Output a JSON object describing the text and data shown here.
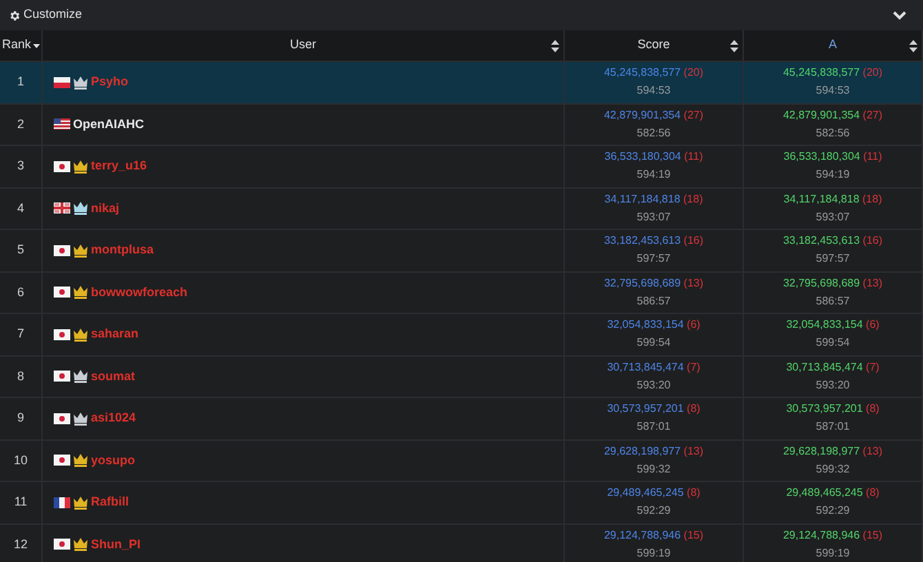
{
  "toolbar": {
    "label": "Customize"
  },
  "columns": [
    {
      "label": "Rank",
      "sorted": true,
      "accent": false
    },
    {
      "label": "User",
      "sorted": false,
      "accent": false
    },
    {
      "label": "Score",
      "sorted": false,
      "accent": false
    },
    {
      "label": "A",
      "sorted": false,
      "accent": true
    }
  ],
  "rows": [
    {
      "rank": "1",
      "flag": {
        "kind": "pl"
      },
      "crown": {
        "color": "#c9ced4"
      },
      "name": "Psyho",
      "color": "#e0302a",
      "selected": true,
      "score": "45,245,838,577",
      "penalty": "(20)",
      "time": "594:53",
      "a_score": "45,245,838,577",
      "a_penalty": "(20)",
      "a_time": "594:53"
    },
    {
      "rank": "2",
      "flag": {
        "kind": "us"
      },
      "name": "OpenAIAHC",
      "color": "#e8e8e8",
      "selected": false,
      "score": "42,879,901,354",
      "penalty": "(27)",
      "time": "582:56",
      "a_score": "42,879,901,354",
      "a_penalty": "(27)",
      "a_time": "582:56"
    },
    {
      "rank": "3",
      "flag": {
        "kind": "jp"
      },
      "crown": {
        "color": "#e0b422"
      },
      "name": "terry_u16",
      "color": "#e0302a",
      "selected": false,
      "score": "36,533,180,304",
      "penalty": "(11)",
      "time": "594:19",
      "a_score": "36,533,180,304",
      "a_penalty": "(11)",
      "a_time": "594:19"
    },
    {
      "rank": "4",
      "flag": {
        "kind": "gb"
      },
      "crown": {
        "color": "#a8d8e8"
      },
      "name": "nikaj",
      "color": "#e0302a",
      "selected": false,
      "score": "34,117,184,818",
      "penalty": "(18)",
      "time": "593:07",
      "a_score": "34,117,184,818",
      "a_penalty": "(18)",
      "a_time": "593:07"
    },
    {
      "rank": "5",
      "flag": {
        "kind": "jp"
      },
      "crown": {
        "color": "#e0b422"
      },
      "name": "montplusa",
      "color": "#e0302a",
      "selected": false,
      "score": "33,182,453,613",
      "penalty": "(16)",
      "time": "597:57",
      "a_score": "33,182,453,613",
      "a_penalty": "(16)",
      "a_time": "597:57"
    },
    {
      "rank": "6",
      "flag": {
        "kind": "jp"
      },
      "crown": {
        "color": "#e0b422"
      },
      "name": "bowwowforeach",
      "color": "#e0302a",
      "selected": false,
      "score": "32,795,698,689",
      "penalty": "(13)",
      "time": "586:57",
      "a_score": "32,795,698,689",
      "a_penalty": "(13)",
      "a_time": "586:57"
    },
    {
      "rank": "7",
      "flag": {
        "kind": "jp"
      },
      "crown": {
        "color": "#e0b422"
      },
      "name": "saharan",
      "color": "#e0302a",
      "selected": false,
      "score": "32,054,833,154",
      "penalty": "(6)",
      "time": "599:54",
      "a_score": "32,054,833,154",
      "a_penalty": "(6)",
      "a_time": "599:54"
    },
    {
      "rank": "8",
      "flag": {
        "kind": "jp"
      },
      "crown": {
        "color": "#c9ced4"
      },
      "name": "soumat",
      "color": "#e0302a",
      "selected": false,
      "score": "30,713,845,474",
      "penalty": "(7)",
      "time": "593:20",
      "a_score": "30,713,845,474",
      "a_penalty": "(7)",
      "a_time": "593:20"
    },
    {
      "rank": "9",
      "flag": {
        "kind": "jp"
      },
      "crown": {
        "color": "#c9ced4"
      },
      "name": "asi1024",
      "color": "#e0302a",
      "selected": false,
      "score": "30,573,957,201",
      "penalty": "(8)",
      "time": "587:01",
      "a_score": "30,573,957,201",
      "a_penalty": "(8)",
      "a_time": "587:01"
    },
    {
      "rank": "10",
      "flag": {
        "kind": "jp"
      },
      "crown": {
        "color": "#e0b422"
      },
      "name": "yosupo",
      "color": "#e0302a",
      "selected": false,
      "score": "29,628,198,977",
      "penalty": "(13)",
      "time": "599:32",
      "a_score": "29,628,198,977",
      "a_penalty": "(13)",
      "a_time": "599:32"
    },
    {
      "rank": "11",
      "flag": {
        "kind": "fr"
      },
      "crown": {
        "color": "#e0b422"
      },
      "name": "Rafbill",
      "color": "#e0302a",
      "selected": false,
      "score": "29,489,465,245",
      "penalty": "(8)",
      "time": "592:29",
      "a_score": "29,489,465,245",
      "a_penalty": "(8)",
      "a_time": "592:29"
    },
    {
      "rank": "12",
      "flag": {
        "kind": "jp"
      },
      "crown": {
        "color": "#e0b422"
      },
      "name": "Shun_PI",
      "color": "#e0302a",
      "selected": false,
      "score": "29,124,788,946",
      "penalty": "(15)",
      "time": "599:19",
      "a_score": "29,124,788,946",
      "a_penalty": "(15)",
      "a_time": "599:19"
    }
  ]
}
